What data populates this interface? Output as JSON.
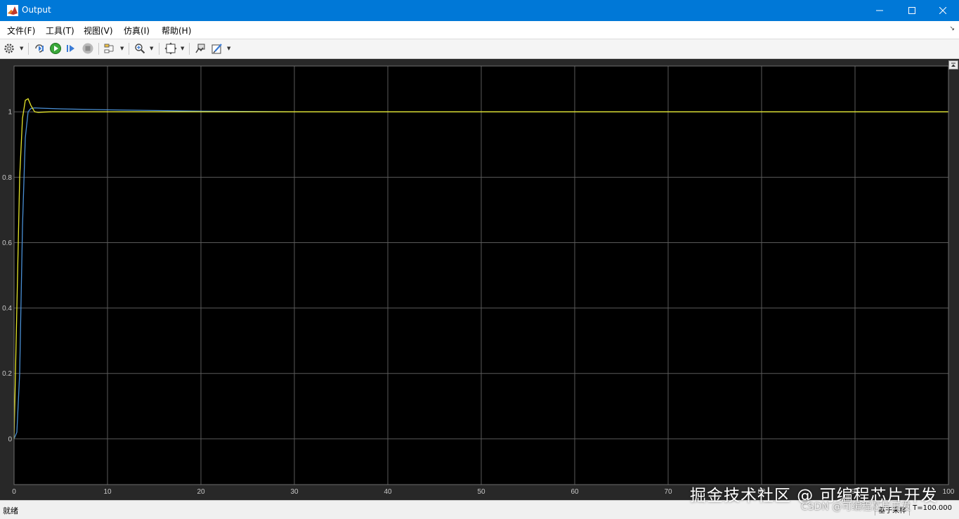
{
  "window": {
    "title": "Output"
  },
  "menu": {
    "items": [
      "文件(F)",
      "工具(T)",
      "视图(V)",
      "仿真(I)",
      "帮助(H)"
    ]
  },
  "toolbar": {
    "buttons": [
      {
        "icon": "gear-icon"
      },
      {
        "icon": "step-back-icon"
      },
      {
        "icon": "run-icon"
      },
      {
        "icon": "step-forward-icon"
      },
      {
        "icon": "stop-icon"
      },
      {
        "icon": "highlight-icon"
      },
      {
        "icon": "zoom-icon"
      },
      {
        "icon": "autoscale-icon"
      },
      {
        "icon": "restore-icon"
      },
      {
        "icon": "style-icon"
      }
    ]
  },
  "status": {
    "left": "就绪",
    "mode": "基于采样",
    "time": "T=100.000"
  },
  "watermark": {
    "line1": "掘金技术社区 @ 可编程芯片开发",
    "line2": "CSDN @可编程芯片开发"
  },
  "colors": {
    "background": "#000000",
    "grid": "#5a5a5a",
    "series_1": "#e6e62a",
    "series_2": "#4a8fd4"
  },
  "chart_data": {
    "type": "line",
    "xlim": [
      0,
      100
    ],
    "ylim": [
      -0.14,
      1.14
    ],
    "xticks": [
      0,
      10,
      20,
      30,
      40,
      50,
      60,
      70,
      80,
      90,
      100
    ],
    "yticks": [
      0,
      0.2,
      0.4,
      0.6,
      0.8,
      1
    ],
    "grid": true,
    "series": [
      {
        "color": "#e6e62a",
        "x": [
          0,
          0.3,
          0.6,
          0.9,
          1.2,
          1.5,
          1.8,
          2.2,
          2.6,
          3.0,
          4,
          6,
          10,
          20,
          40,
          100
        ],
        "y": [
          0,
          0.4,
          0.8,
          0.98,
          1.035,
          1.04,
          1.02,
          1.0,
          0.998,
          0.999,
          1.0,
          1.0,
          1.0,
          1.0,
          1.0,
          1.0
        ]
      },
      {
        "color": "#4a8fd4",
        "x": [
          0,
          0.3,
          0.6,
          0.9,
          1.2,
          1.5,
          1.8,
          2.2,
          3,
          5,
          10,
          20,
          30,
          40,
          100
        ],
        "y": [
          0,
          0.02,
          0.2,
          0.65,
          0.92,
          1.0,
          1.01,
          1.012,
          1.011,
          1.009,
          1.006,
          1.002,
          1.0,
          1.0,
          1.0
        ]
      }
    ]
  }
}
